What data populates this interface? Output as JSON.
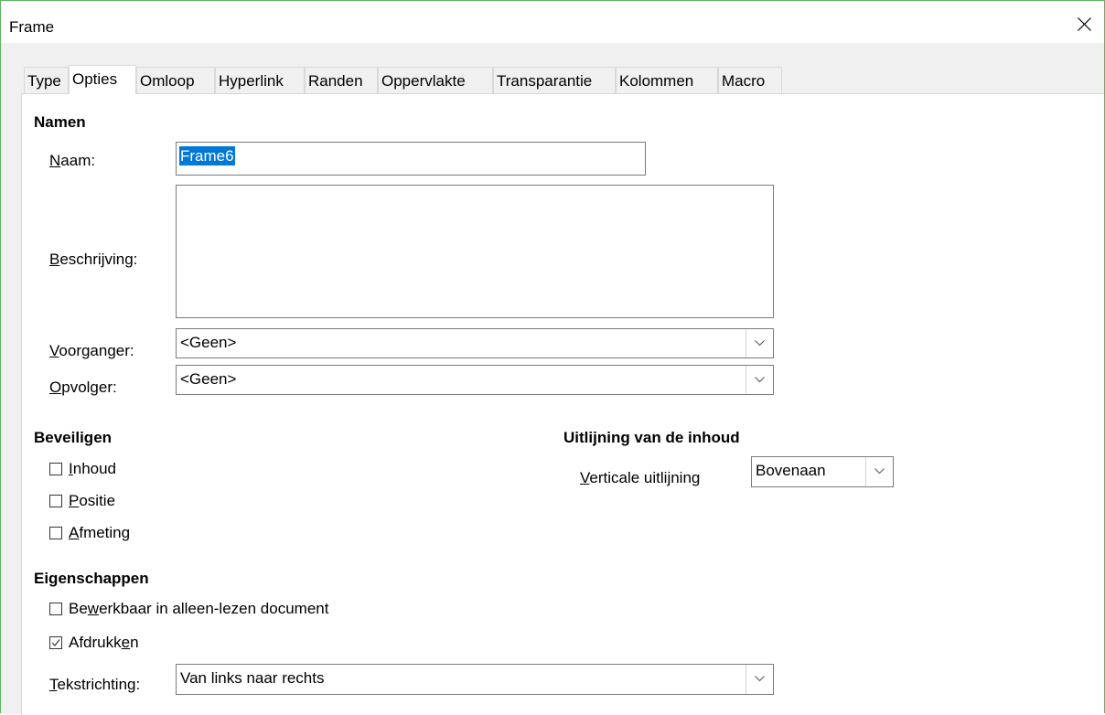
{
  "window": {
    "title": "Frame"
  },
  "tabs": [
    {
      "label": "Type"
    },
    {
      "label": "Opties",
      "active": true
    },
    {
      "label": "Omloop"
    },
    {
      "label": "Hyperlink"
    },
    {
      "label": "Randen"
    },
    {
      "label": "Oppervlakte"
    },
    {
      "label": "Transparantie"
    },
    {
      "label": "Kolommen"
    },
    {
      "label": "Macro"
    }
  ],
  "names": {
    "title": "Namen",
    "name_label": "Naam:",
    "name_value": "Frame6",
    "description_label": "Beschrijving:",
    "description_value": "",
    "previous_label": "Voorganger:",
    "previous_value": "<Geen>",
    "next_label": "Opvolger:",
    "next_value": "<Geen>"
  },
  "protect": {
    "title": "Beveiligen",
    "items": [
      {
        "label": "Inhoud",
        "checked": false
      },
      {
        "label": "Positie",
        "checked": false
      },
      {
        "label": "Afmeting",
        "checked": false
      }
    ]
  },
  "alignment": {
    "title": "Uitlijning van de inhoud",
    "vertical_label": "Verticale uitlijning",
    "vertical_value": "Bovenaan"
  },
  "properties": {
    "title": "Eigenschappen",
    "items": [
      {
        "label": "Bewerkbaar in alleen-lezen document",
        "checked": false
      },
      {
        "label": "Afdrukken",
        "checked": true
      }
    ],
    "direction_label": "Tekstrichting:",
    "direction_value": "Van links naar rechts"
  },
  "icons": {
    "close": "close-icon",
    "dropdown": "chevron-down-icon",
    "check": "checkmark-icon"
  },
  "colors": {
    "window_border": "#5fb35f",
    "selection": "#0078d7",
    "dialog_bg": "#f0f0f0"
  }
}
